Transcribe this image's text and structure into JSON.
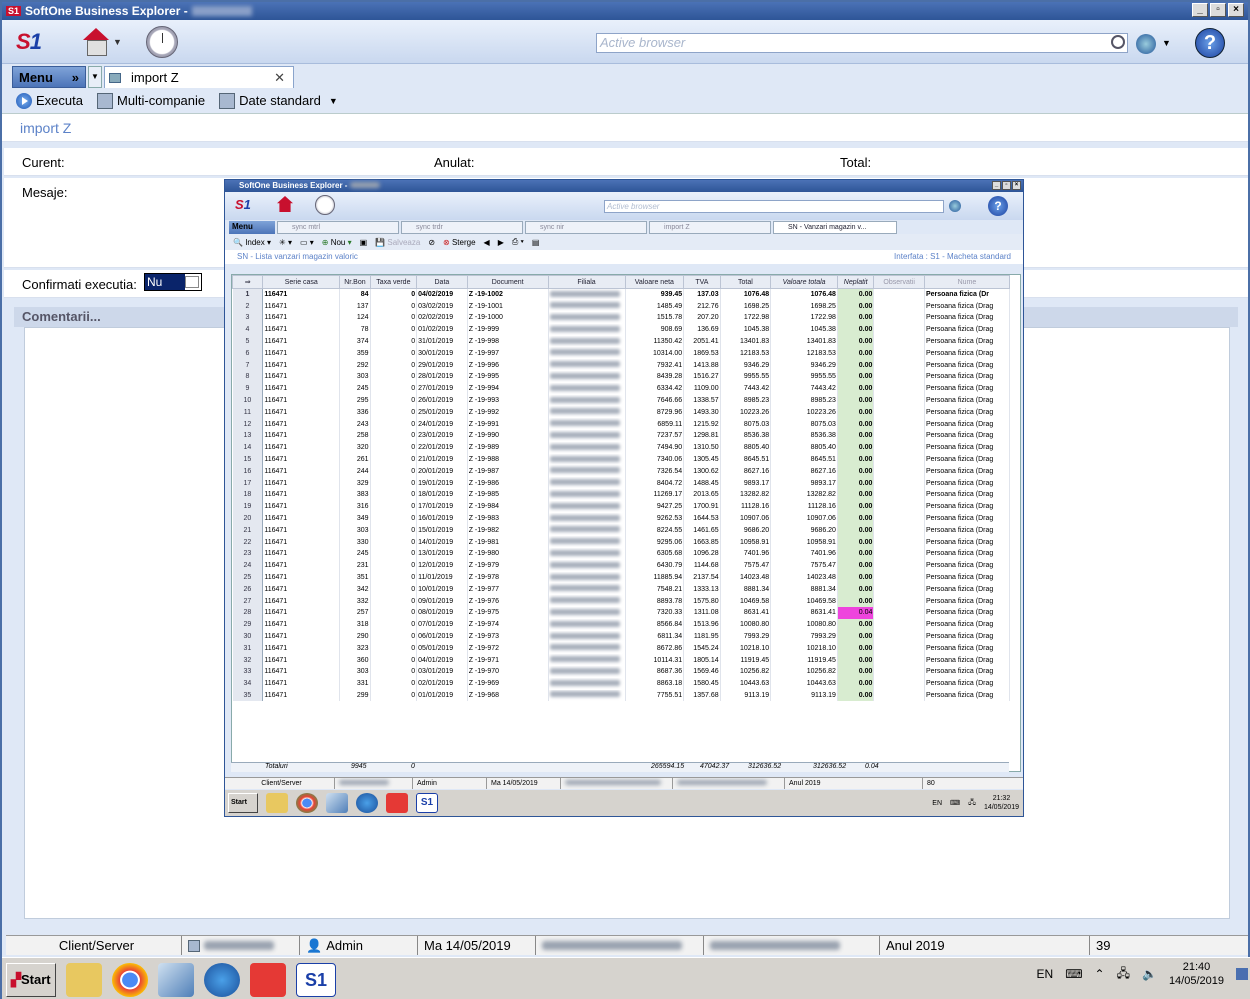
{
  "window": {
    "title": "SoftOne Business Explorer -",
    "logo": "S1"
  },
  "toolbar": {
    "search_placeholder": "Active browser",
    "icons": [
      "home-icon",
      "clock-icon",
      "search-icon",
      "globe-icon",
      "help-icon"
    ]
  },
  "tabs": {
    "menu_label": "Menu",
    "active_tab": "import Z"
  },
  "actions": {
    "execute": "Executa",
    "multi": "Multi-companie",
    "date": "Date standard"
  },
  "page": {
    "title": "import Z",
    "current_label": "Curent:",
    "cancelled_label": "Anulat:",
    "total_label": "Total:",
    "messages_label": "Mesaje:",
    "confirm_label": "Confirmati executia:",
    "confirm_value": "Nu",
    "comments_label": "Comentarii..."
  },
  "statusbar": {
    "mode": "Client/Server",
    "user": "Admin",
    "date": "Ma 14/05/2019",
    "year": "Anul 2019",
    "count": "39"
  },
  "taskbar": {
    "start": "Start",
    "lang": "EN",
    "time": "21:40",
    "date": "14/05/2019"
  },
  "inner": {
    "title": "SoftOne Business Explorer -",
    "search_placeholder": "Active browser",
    "menu_label": "Menu",
    "tabs": [
      "sync mtrl",
      "sync trdr",
      "sync nir",
      "import Z",
      "SN - Vanzari magazin v..."
    ],
    "toolbar": {
      "index": "Index",
      "nou": "Nou",
      "salveaza": "Salveaza",
      "sterge": "Sterge"
    },
    "list_title": "SN - Lista vanzari magazin valoric",
    "interface": "Interfata : S1 - Macheta standard",
    "columns": [
      "Serie casa",
      "Nr.Bon",
      "Taxa verde",
      "Data",
      "Document",
      "Filiala",
      "Valoare neta",
      "TVA",
      "Total",
      "Valoare totala",
      "Neplatit",
      "Observatii",
      "Nume"
    ],
    "rows": [
      [
        "116471",
        "84",
        "0",
        "04/02/2019",
        "Z -19-1002",
        "939.45",
        "137.03",
        "1076.48",
        "1076.48",
        "0.00",
        "Persoana fizica (Dr"
      ],
      [
        "116471",
        "137",
        "0",
        "03/02/2019",
        "Z -19-1001",
        "1485.49",
        "212.76",
        "1698.25",
        "1698.25",
        "0.00",
        "Persoana fizica (Drag"
      ],
      [
        "116471",
        "124",
        "0",
        "02/02/2019",
        "Z -19-1000",
        "1515.78",
        "207.20",
        "1722.98",
        "1722.98",
        "0.00",
        "Persoana fizica (Drag"
      ],
      [
        "116471",
        "78",
        "0",
        "01/02/2019",
        "Z -19-999",
        "908.69",
        "136.69",
        "1045.38",
        "1045.38",
        "0.00",
        "Persoana fizica (Drag"
      ],
      [
        "116471",
        "374",
        "0",
        "31/01/2019",
        "Z -19-998",
        "11350.42",
        "2051.41",
        "13401.83",
        "13401.83",
        "0.00",
        "Persoana fizica (Drag"
      ],
      [
        "116471",
        "359",
        "0",
        "30/01/2019",
        "Z -19-997",
        "10314.00",
        "1869.53",
        "12183.53",
        "12183.53",
        "0.00",
        "Persoana fizica (Drag"
      ],
      [
        "116471",
        "292",
        "0",
        "29/01/2019",
        "Z -19-996",
        "7932.41",
        "1413.88",
        "9346.29",
        "9346.29",
        "0.00",
        "Persoana fizica (Drag"
      ],
      [
        "116471",
        "303",
        "0",
        "28/01/2019",
        "Z -19-995",
        "8439.28",
        "1516.27",
        "9955.55",
        "9955.55",
        "0.00",
        "Persoana fizica (Drag"
      ],
      [
        "116471",
        "245",
        "0",
        "27/01/2019",
        "Z -19-994",
        "6334.42",
        "1109.00",
        "7443.42",
        "7443.42",
        "0.00",
        "Persoana fizica (Drag"
      ],
      [
        "116471",
        "295",
        "0",
        "26/01/2019",
        "Z -19-993",
        "7646.66",
        "1338.57",
        "8985.23",
        "8985.23",
        "0.00",
        "Persoana fizica (Drag"
      ],
      [
        "116471",
        "336",
        "0",
        "25/01/2019",
        "Z -19-992",
        "8729.96",
        "1493.30",
        "10223.26",
        "10223.26",
        "0.00",
        "Persoana fizica (Drag"
      ],
      [
        "116471",
        "243",
        "0",
        "24/01/2019",
        "Z -19-991",
        "6859.11",
        "1215.92",
        "8075.03",
        "8075.03",
        "0.00",
        "Persoana fizica (Drag"
      ],
      [
        "116471",
        "258",
        "0",
        "23/01/2019",
        "Z -19-990",
        "7237.57",
        "1298.81",
        "8536.38",
        "8536.38",
        "0.00",
        "Persoana fizica (Drag"
      ],
      [
        "116471",
        "320",
        "0",
        "22/01/2019",
        "Z -19-989",
        "7494.90",
        "1310.50",
        "8805.40",
        "8805.40",
        "0.00",
        "Persoana fizica (Drag"
      ],
      [
        "116471",
        "261",
        "0",
        "21/01/2019",
        "Z -19-988",
        "7340.06",
        "1305.45",
        "8645.51",
        "8645.51",
        "0.00",
        "Persoana fizica (Drag"
      ],
      [
        "116471",
        "244",
        "0",
        "20/01/2019",
        "Z -19-987",
        "7326.54",
        "1300.62",
        "8627.16",
        "8627.16",
        "0.00",
        "Persoana fizica (Drag"
      ],
      [
        "116471",
        "329",
        "0",
        "19/01/2019",
        "Z -19-986",
        "8404.72",
        "1488.45",
        "9893.17",
        "9893.17",
        "0.00",
        "Persoana fizica (Drag"
      ],
      [
        "116471",
        "383",
        "0",
        "18/01/2019",
        "Z -19-985",
        "11269.17",
        "2013.65",
        "13282.82",
        "13282.82",
        "0.00",
        "Persoana fizica (Drag"
      ],
      [
        "116471",
        "316",
        "0",
        "17/01/2019",
        "Z -19-984",
        "9427.25",
        "1700.91",
        "11128.16",
        "11128.16",
        "0.00",
        "Persoana fizica (Drag"
      ],
      [
        "116471",
        "349",
        "0",
        "16/01/2019",
        "Z -19-983",
        "9262.53",
        "1644.53",
        "10907.06",
        "10907.06",
        "0.00",
        "Persoana fizica (Drag"
      ],
      [
        "116471",
        "303",
        "0",
        "15/01/2019",
        "Z -19-982",
        "8224.55",
        "1461.65",
        "9686.20",
        "9686.20",
        "0.00",
        "Persoana fizica (Drag"
      ],
      [
        "116471",
        "330",
        "0",
        "14/01/2019",
        "Z -19-981",
        "9295.06",
        "1663.85",
        "10958.91",
        "10958.91",
        "0.00",
        "Persoana fizica (Drag"
      ],
      [
        "116471",
        "245",
        "0",
        "13/01/2019",
        "Z -19-980",
        "6305.68",
        "1096.28",
        "7401.96",
        "7401.96",
        "0.00",
        "Persoana fizica (Drag"
      ],
      [
        "116471",
        "231",
        "0",
        "12/01/2019",
        "Z -19-979",
        "6430.79",
        "1144.68",
        "7575.47",
        "7575.47",
        "0.00",
        "Persoana fizica (Drag"
      ],
      [
        "116471",
        "351",
        "0",
        "11/01/2019",
        "Z -19-978",
        "11885.94",
        "2137.54",
        "14023.48",
        "14023.48",
        "0.00",
        "Persoana fizica (Drag"
      ],
      [
        "116471",
        "342",
        "0",
        "10/01/2019",
        "Z -19-977",
        "7548.21",
        "1333.13",
        "8881.34",
        "8881.34",
        "0.00",
        "Persoana fizica (Drag"
      ],
      [
        "116471",
        "332",
        "0",
        "09/01/2019",
        "Z -19-976",
        "8893.78",
        "1575.80",
        "10469.58",
        "10469.58",
        "0.00",
        "Persoana fizica (Drag"
      ],
      [
        "116471",
        "257",
        "0",
        "08/01/2019",
        "Z -19-975",
        "7320.33",
        "1311.08",
        "8631.41",
        "8631.41",
        "0.04",
        "Persoana fizica (Drag"
      ],
      [
        "116471",
        "318",
        "0",
        "07/01/2019",
        "Z -19-974",
        "8566.84",
        "1513.96",
        "10080.80",
        "10080.80",
        "0.00",
        "Persoana fizica (Drag"
      ],
      [
        "116471",
        "290",
        "0",
        "06/01/2019",
        "Z -19-973",
        "6811.34",
        "1181.95",
        "7993.29",
        "7993.29",
        "0.00",
        "Persoana fizica (Drag"
      ],
      [
        "116471",
        "323",
        "0",
        "05/01/2019",
        "Z -19-972",
        "8672.86",
        "1545.24",
        "10218.10",
        "10218.10",
        "0.00",
        "Persoana fizica (Drag"
      ],
      [
        "116471",
        "360",
        "0",
        "04/01/2019",
        "Z -19-971",
        "10114.31",
        "1805.14",
        "11919.45",
        "11919.45",
        "0.00",
        "Persoana fizica (Drag"
      ],
      [
        "116471",
        "303",
        "0",
        "03/01/2019",
        "Z -19-970",
        "8687.36",
        "1569.46",
        "10256.82",
        "10256.82",
        "0.00",
        "Persoana fizica (Drag"
      ],
      [
        "116471",
        "331",
        "0",
        "02/01/2019",
        "Z -19-969",
        "8863.18",
        "1580.45",
        "10443.63",
        "10443.63",
        "0.00",
        "Persoana fizica (Drag"
      ],
      [
        "116471",
        "299",
        "0",
        "01/01/2019",
        "Z -19-968",
        "7755.51",
        "1357.68",
        "9113.19",
        "9113.19",
        "0.00",
        "Persoana fizica (Drag"
      ]
    ],
    "totals": {
      "label": "Totaluri",
      "nr_bon": "9945",
      "taxa": "0",
      "neta": "265594.15",
      "tva": "47042.37",
      "total": "312636.52",
      "val_tot": "312636.52",
      "neplatit": "0.04"
    },
    "status": {
      "mode": "Client/Server",
      "user": "Admin",
      "date": "Ma 14/05/2019",
      "year": "Anul 2019",
      "count": "80"
    },
    "taskbar": {
      "start": "Start",
      "lang": "EN",
      "time": "21:32",
      "date": "14/05/2019"
    }
  }
}
